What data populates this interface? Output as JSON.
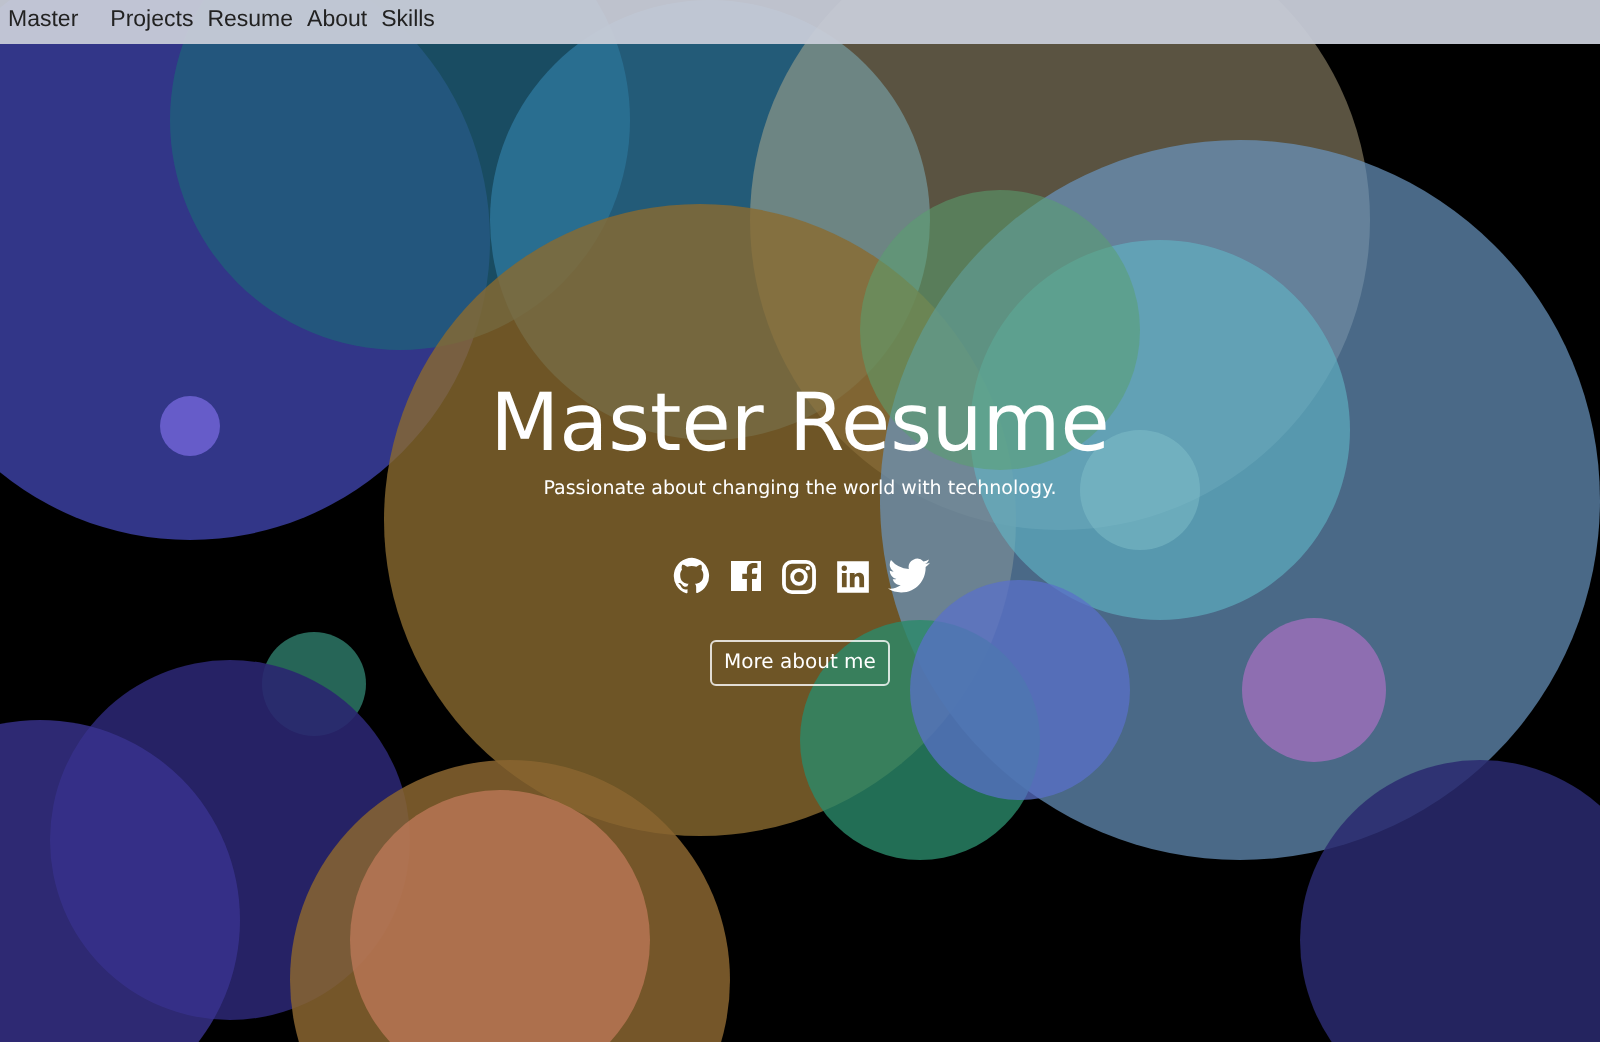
{
  "navbar": {
    "brand": "Master",
    "links": [
      "Projects",
      "Resume",
      "About",
      "Skills"
    ]
  },
  "hero": {
    "title": "Master Resume",
    "tagline": "Passionate about changing the world with technology.",
    "social": [
      {
        "kind": "github"
      },
      {
        "kind": "facebook"
      },
      {
        "kind": "instagram"
      },
      {
        "kind": "linkedin"
      },
      {
        "kind": "twitter"
      }
    ],
    "button": "More about me"
  }
}
